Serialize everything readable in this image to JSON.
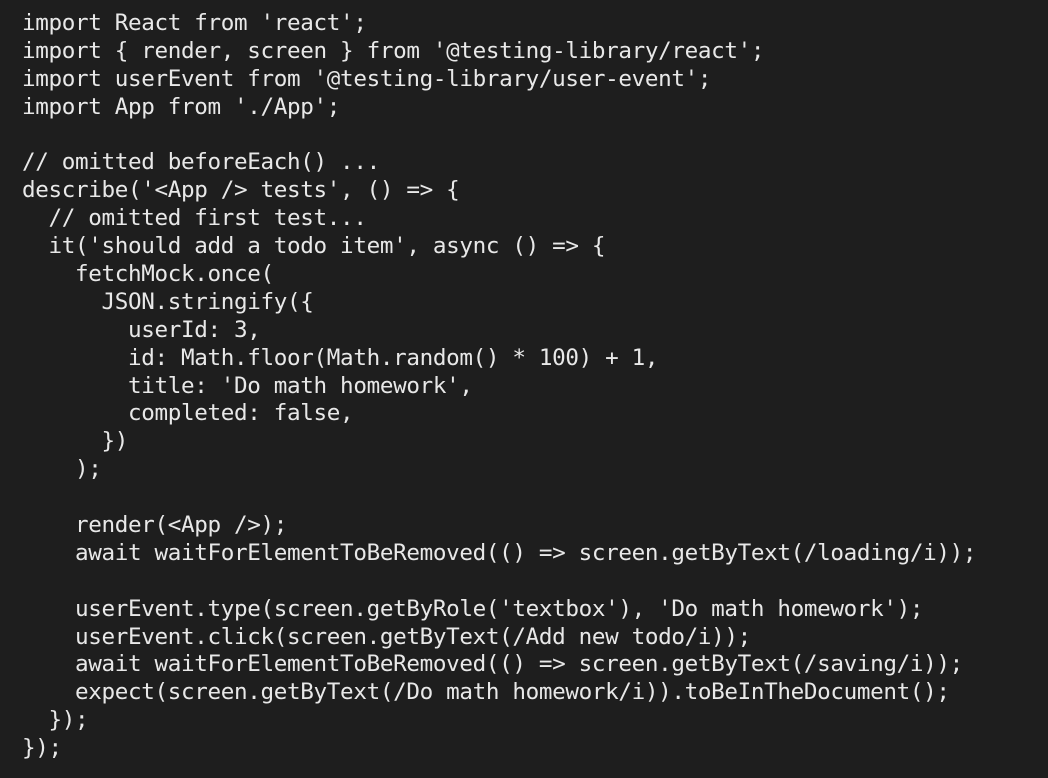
{
  "editor": {
    "lines": [
      "import React from 'react';",
      "import { render, screen } from '@testing-library/react';",
      "import userEvent from '@testing-library/user-event';",
      "import App from './App';",
      "",
      "// omitted beforeEach() ...",
      "describe('<App /> tests', () => {",
      "  // omitted first test...",
      "  it('should add a todo item', async () => {",
      "    fetchMock.once(",
      "      JSON.stringify({",
      "        userId: 3,",
      "        id: Math.floor(Math.random() * 100) + 1,",
      "        title: 'Do math homework',",
      "        completed: false,",
      "      })",
      "    );",
      "",
      "    render(<App />);",
      "    await waitForElementToBeRemoved(() => screen.getByText(/loading/i));",
      "",
      "    userEvent.type(screen.getByRole('textbox'), 'Do math homework');",
      "    userEvent.click(screen.getByText(/Add new todo/i));",
      "    await waitForElementToBeRemoved(() => screen.getByText(/saving/i));",
      "    expect(screen.getByText(/Do math homework/i)).toBeInTheDocument();",
      "  });",
      "});"
    ]
  }
}
